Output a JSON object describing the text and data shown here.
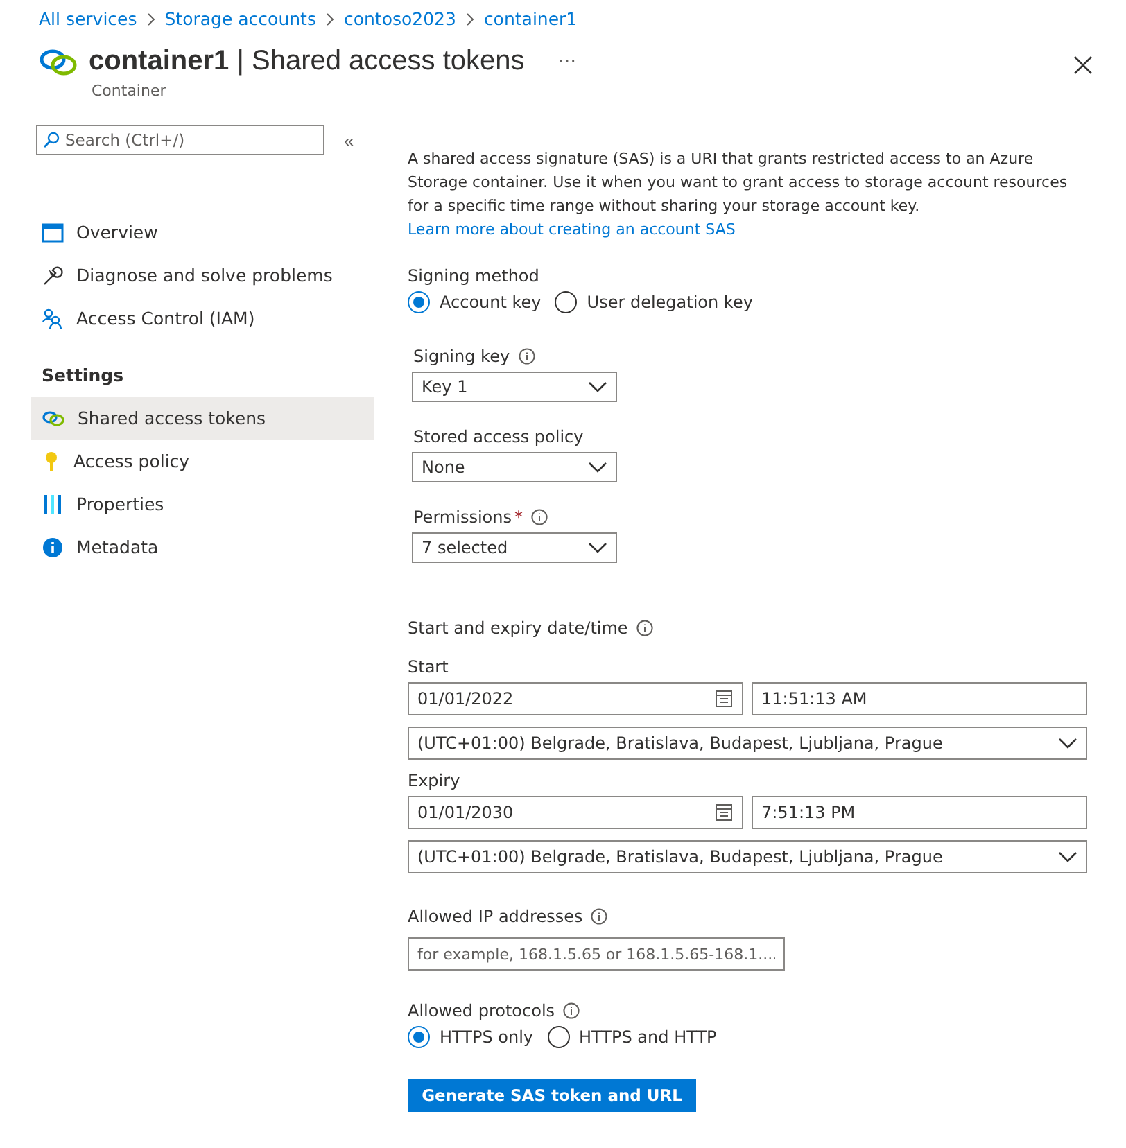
{
  "breadcrumb": [
    "All services",
    "Storage accounts",
    "contoso2023",
    "container1"
  ],
  "header": {
    "title": "container1",
    "separator": "|",
    "section": "Shared access tokens",
    "subtitle": "Container",
    "more": "···"
  },
  "sidebar": {
    "search": {
      "placeholder": "Search (Ctrl+/)"
    },
    "collapse": "«",
    "items": [
      {
        "label": "Overview",
        "kind": "overview",
        "selected": false
      },
      {
        "label": "Diagnose and solve problems",
        "kind": "wrench",
        "selected": false
      },
      {
        "label": "Access Control (IAM)",
        "kind": "people",
        "selected": false
      }
    ],
    "section": "Settings",
    "settings_items": [
      {
        "label": "Shared access tokens",
        "kind": "links",
        "selected": true
      },
      {
        "label": "Access policy",
        "kind": "key",
        "selected": false
      },
      {
        "label": "Properties",
        "kind": "bars",
        "selected": false
      },
      {
        "label": "Metadata",
        "kind": "info",
        "selected": false
      }
    ]
  },
  "description": {
    "text": "A shared access signature (SAS) is a URI that grants restricted access to an Azure Storage container. Use it when you want to grant access to storage account resources for a specific time range without sharing your storage account key.",
    "link": "Learn more about creating an account SAS"
  },
  "signing_method": {
    "label": "Signing method",
    "options": [
      {
        "label": "Account key",
        "selected": true
      },
      {
        "label": "User delegation key",
        "selected": false
      }
    ]
  },
  "dropdowns": [
    {
      "label": "Signing key",
      "info": true,
      "value": "Key 1"
    },
    {
      "label": "Stored access policy",
      "info": false,
      "value": "None"
    },
    {
      "label": "Permissions",
      "required_mark": "*",
      "info": true,
      "value": "7 selected"
    }
  ],
  "dates": {
    "label": "Start and expiry date/time",
    "groups": [
      {
        "label": "Start",
        "date": "01/01/2022",
        "time": "11:51:13 AM",
        "timezone": "(UTC+01:00) Belgrade, Bratislava, Budapest, Ljubljana, Prague"
      },
      {
        "label": "Expiry",
        "date": "01/01/2030",
        "time": "7:51:13 PM",
        "timezone": "(UTC+01:00) Belgrade, Bratislava, Budapest, Ljubljana, Prague"
      }
    ]
  },
  "allowed_ip": {
    "label": "Allowed IP addresses",
    "placeholder": "for example, 168.1.5.65 or 168.1.5.65-168.1...."
  },
  "protocols": {
    "label": "Allowed protocols",
    "options": [
      {
        "label": "HTTPS only",
        "selected": true
      },
      {
        "label": "HTTPS and HTTP",
        "selected": false
      }
    ]
  },
  "generate_button": "Generate SAS token and URL"
}
